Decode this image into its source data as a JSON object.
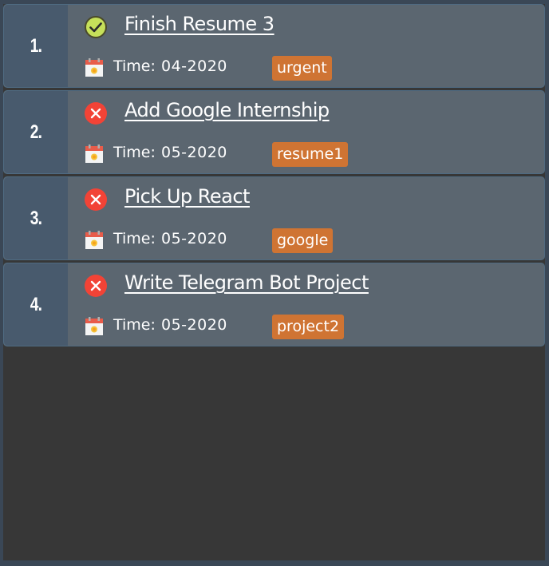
{
  "time_label": "Time:",
  "colors": {
    "background": "#3a4756",
    "card": "#5b6670",
    "index_box": "#485a6d",
    "empty_area": "#373737",
    "tag": "#cf7433",
    "done": "#c6e05a",
    "not_done": "#f24336"
  },
  "tasks": [
    {
      "index": "1.",
      "title": "Finish Resume 3",
      "status_icon": "check-circle-icon",
      "time": "04-2020",
      "tag": "urgent"
    },
    {
      "index": "2.",
      "title": "Add Google Internship",
      "status_icon": "cross-circle-icon",
      "time": "05-2020",
      "tag": "resume1"
    },
    {
      "index": "3.",
      "title": "Pick Up React",
      "status_icon": "cross-circle-icon",
      "time": "05-2020",
      "tag": "google"
    },
    {
      "index": "4.",
      "title": "Write Telegram Bot Project",
      "status_icon": "cross-circle-icon",
      "time": "05-2020",
      "tag": "project2"
    }
  ]
}
